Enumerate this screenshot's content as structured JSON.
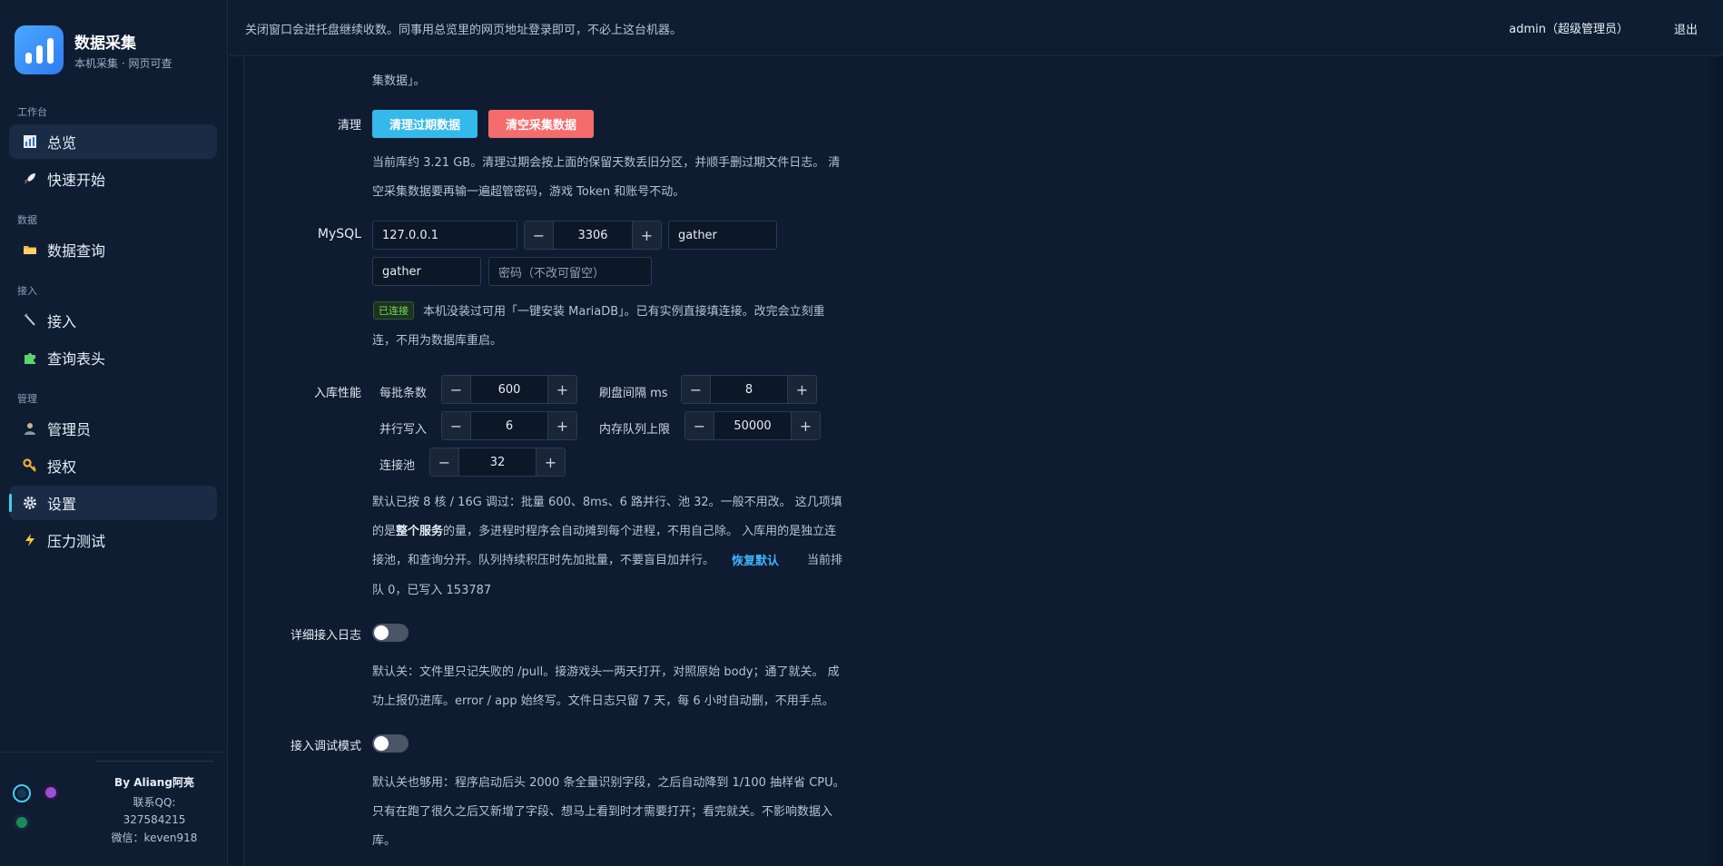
{
  "app": {
    "title": "数据采集",
    "subtitle": "本机采集 · 网页可查"
  },
  "sidebar": {
    "sections": [
      "工作台",
      "数据",
      "接入",
      "管理"
    ],
    "items": [
      {
        "label": "总览",
        "icon": "bar-chart-icon"
      },
      {
        "label": "快速开始",
        "icon": "rocket-icon"
      },
      {
        "label": "数据查询",
        "icon": "folder-icon"
      },
      {
        "label": "接入",
        "icon": "plug-icon"
      },
      {
        "label": "查询表头",
        "icon": "puzzle-icon"
      },
      {
        "label": "管理员",
        "icon": "user-icon"
      },
      {
        "label": "授权",
        "icon": "key-icon"
      },
      {
        "label": "设置",
        "icon": "gear-icon"
      },
      {
        "label": "压力测试",
        "icon": "lightning-icon"
      }
    ],
    "footer": {
      "by": "By Aliang阿亮",
      "qq_label": "联系QQ:",
      "qq": "327584215",
      "wechat": "微信：keven918"
    }
  },
  "topbar": {
    "notice": "关闭窗口会进托盘继续收数。同事用总览里的网页地址登录即可，不必上这台机器。",
    "user": "admin（超级管理员）",
    "logout": "退出"
  },
  "settings": {
    "prev_tail": "集数据」。",
    "cleanup": {
      "label": "清理",
      "btn_expired": "清理过期数据",
      "btn_clear": "清空采集数据",
      "desc1": "当前库约 3.21 GB。清理过期会按上面的保留天数丢旧分区，并顺手删过期文件日志。 清",
      "desc2": "空采集数据要再输一遍超管密码，游戏 Token 和账号不动。"
    },
    "mysql": {
      "label": "MySQL",
      "host": "127.0.0.1",
      "port": "3306",
      "database": "gather",
      "user": "gather",
      "password_placeholder": "密码（不改可留空）",
      "status": "已连接",
      "desc1": "本机没装过可用「一键安装 MariaDB」。已有实例直接填连接。改完会立刻重",
      "desc2": "连，不用为数据库重启。"
    },
    "perf": {
      "label": "入库性能",
      "batch_label": "每批条数",
      "batch": "600",
      "flush_label": "刷盘间隔 ms",
      "flush": "8",
      "parallel_label": "并行写入",
      "parallel": "6",
      "queue_label": "内存队列上限",
      "queue": "50000",
      "pool_label": "连接池",
      "pool": "32",
      "desc1": "默认已按 8 核 / 16G 调过：批量 600、8ms、6 路并行、池 32。一般不用改。 这几项填",
      "desc2a": "的是",
      "desc2b": "整个服务",
      "desc2c": "的量，多进程时程序会自动摊到每个进程，不用自己除。 入库用的是独立连",
      "desc3": "接池，和查询分开。队列持续积压时先加批量，不要盲目加并行。",
      "restore": "恢复默认",
      "desc3b": "当前排",
      "desc4": "队 0，已写入 153787"
    },
    "verbose_log": {
      "label": "详细接入日志",
      "desc1": "默认关：文件里只记失败的 /pull。接游戏头一两天打开，对照原始 body；通了就关。 成",
      "desc2": "功上报仍进库。error / app 始终写。文件日志只留 7 天，每 6 小时自动删，不用手点。"
    },
    "debug_mode": {
      "label": "接入调试模式",
      "desc1": "默认关也够用：程序启动后头 2000 条全量识别字段，之后自动降到 1/100 抽样省 CPU。",
      "desc2": "只有在跑了很久之后又新增了字段、想马上看到时才需要打开；看完就关。不影响数据入",
      "desc3": "库。"
    }
  }
}
